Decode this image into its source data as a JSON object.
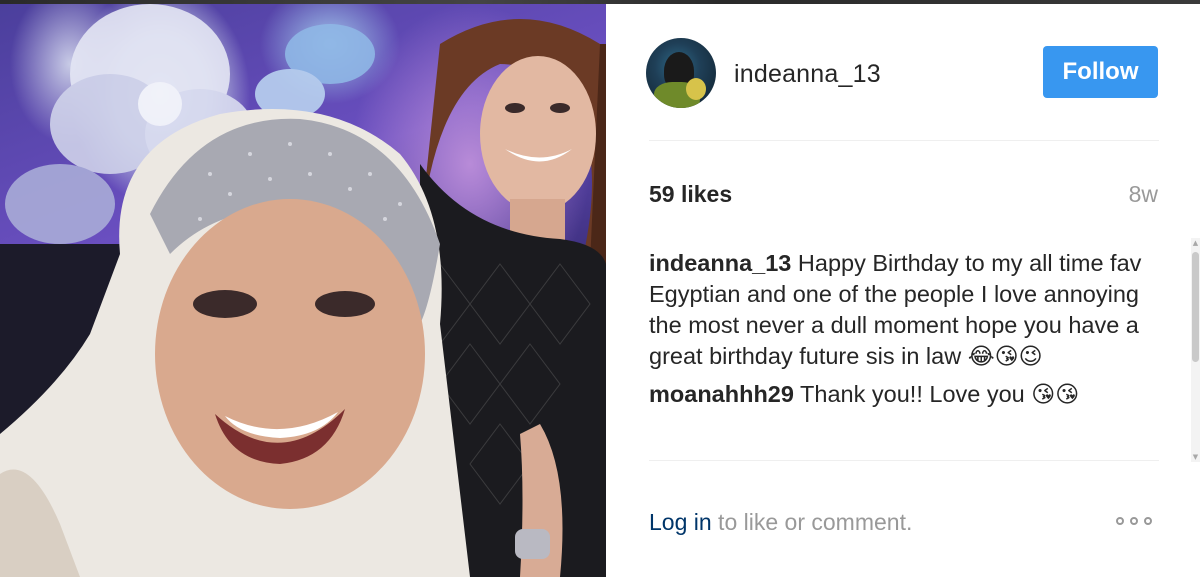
{
  "photo": {
    "description_icon": "photo"
  },
  "post": {
    "username": "indeanna_13",
    "follow_label": "Follow",
    "likes": "59 likes",
    "time": "8w"
  },
  "comments": [
    {
      "user": "indeanna_13",
      "text": " Happy Birthday to my all time fav Egyptian and one of the people I love annoying the most never a dull moment hope you have a great birthday future sis in law ",
      "emojis": "😂😘😉"
    },
    {
      "user": "moanahhh29",
      "text": " Thank you!! Love you ",
      "emojis": "😘😘"
    }
  ],
  "footer": {
    "login_link": "Log in",
    "login_rest": " to like or comment."
  },
  "colors": {
    "accent": "#3897f0",
    "link": "#003569",
    "muted": "#999999",
    "text": "#262626"
  }
}
